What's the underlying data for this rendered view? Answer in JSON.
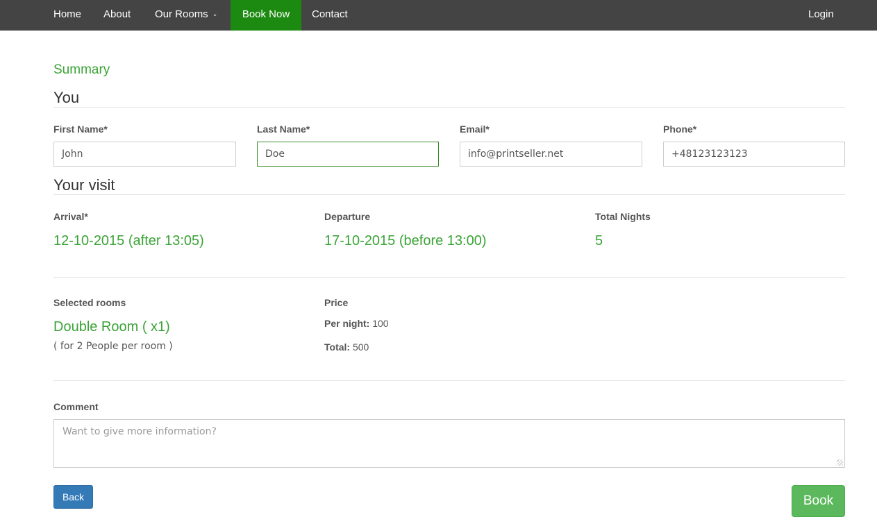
{
  "nav": {
    "home": "Home",
    "about": "About",
    "our_rooms": "Our Rooms",
    "book_now": "Book Now",
    "contact": "Contact",
    "login": "Login"
  },
  "summary": {
    "title": "Summary",
    "you_heading": "You",
    "fields": {
      "first_name_label": "First Name*",
      "first_name_value": "John",
      "last_name_label": "Last Name*",
      "last_name_value": "Doe",
      "email_label": "Email*",
      "email_value": "info@printseller.net",
      "phone_label": "Phone*",
      "phone_value": "+48123123123"
    },
    "visit_heading": "Your visit",
    "visit": {
      "arrival_label": "Arrival*",
      "arrival_value": "12-10-2015 (after 13:05)",
      "departure_label": "Departure",
      "departure_value": "17-10-2015 (before 13:00)",
      "nights_label": "Total Nights",
      "nights_value": "5"
    },
    "rooms": {
      "selected_label": "Selected rooms",
      "room_name": "Double Room ( x1)",
      "room_detail": "( for 2 People per room )",
      "price_label": "Price",
      "per_night_label": "Per night:",
      "per_night_value": "100",
      "total_label": "Total:",
      "total_value": "500"
    },
    "comment": {
      "label": "Comment",
      "placeholder": "Want to give more information?"
    },
    "buttons": {
      "back": "Back",
      "book": "Book"
    }
  },
  "colors": {
    "accent_green": "#3aa336",
    "nav_active": "#1c8a10",
    "nav_bg": "#444444",
    "back_button": "#337ab7",
    "book_button": "#5cb85c"
  }
}
